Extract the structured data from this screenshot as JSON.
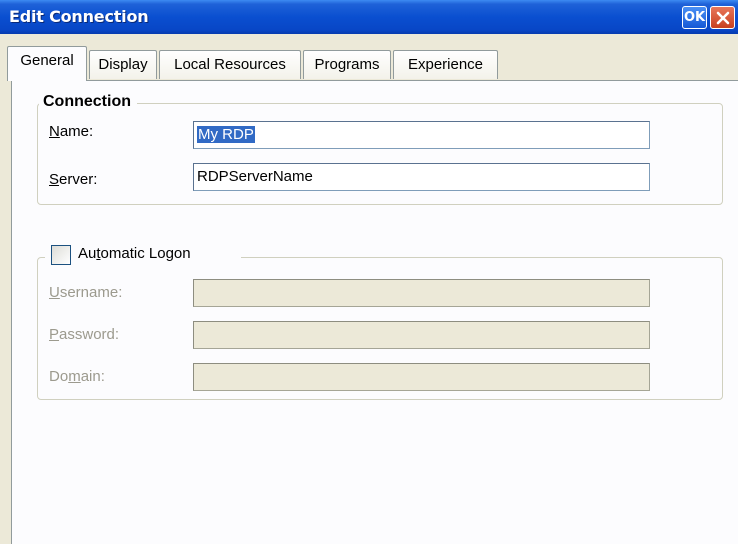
{
  "window": {
    "title": "Edit Connection",
    "ok_label": "OK"
  },
  "tabs": [
    {
      "label": "General",
      "active": true
    },
    {
      "label": "Display",
      "active": false
    },
    {
      "label": "Local Resources",
      "active": false
    },
    {
      "label": "Programs",
      "active": false
    },
    {
      "label": "Experience",
      "active": false
    }
  ],
  "connection": {
    "group_label": "Connection",
    "name_label": "Name:",
    "name_value": "My RDP",
    "server_label": "Server:",
    "server_value": "RDPServerName"
  },
  "logon": {
    "checkbox_label": "Automatic Logon",
    "checked": false,
    "username_label": "Username:",
    "username_value": "",
    "password_label": "Password:",
    "password_value": "",
    "domain_label": "Domain:",
    "domain_value": ""
  },
  "colors": {
    "titlebar": "#0A4FD0",
    "selection": "#316AC5",
    "dialog_bg": "#ECE9D8",
    "panel_bg": "#FCFCFE"
  }
}
